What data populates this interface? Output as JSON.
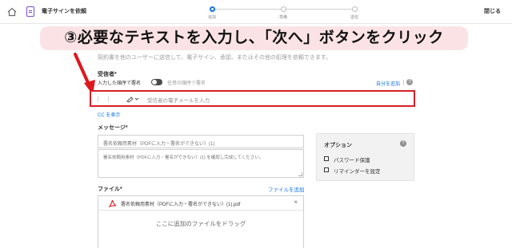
{
  "header": {
    "title": "電子サインを依頼",
    "close_label": "閉じる",
    "steps": [
      "追加",
      "準備",
      "送信"
    ],
    "active_step_index": 0
  },
  "banner": {
    "text": "③必要なテキストを入力し、「次へ」ボタンをクリック"
  },
  "intro_text": "契約書を他のユーザーに送信して、電子サイン、承認、またはその他の処理を依頼できます。",
  "recipients": {
    "label": "受信者*",
    "order_label": "入力した順序で署名",
    "order_alt_label": "任意の順序で署名",
    "add_self_label": "自分を追加",
    "email_placeholder": "受信者の電子メールを入力",
    "cc_label": "CC を表示"
  },
  "message": {
    "label": "メッセージ*",
    "subject_value": "署名依頼用素材（PDFに入力・署名ができない）(1)",
    "body_value": "署名依頼用素材（PDFに入力・署名ができない）(1) を確認し完成してください。"
  },
  "options": {
    "title": "オプション",
    "items": [
      "パスワード保護",
      "リマインダーを設定"
    ]
  },
  "files": {
    "label": "ファイル*",
    "add_label": "ファイルを追加",
    "items": [
      {
        "name": "署名依頼用素材（PDFに入力・署名ができない）(1).pdf",
        "remove_label": "×"
      }
    ],
    "drop_text": "ここに追加のファイルをドラッグ"
  },
  "colors": {
    "accent": "#1473e6",
    "highlight_border": "#d81e26",
    "banner_bg": "#fbe3e5",
    "arrow": "#e0161e"
  }
}
